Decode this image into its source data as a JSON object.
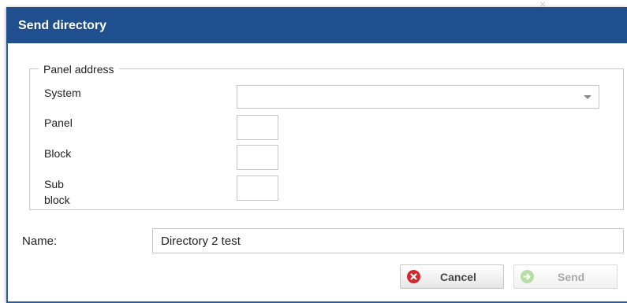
{
  "dialog": {
    "title": "Send directory"
  },
  "panel_address": {
    "legend": "Panel address",
    "system_label": "System",
    "system_value": "",
    "panel_label": "Panel",
    "panel_value": "",
    "block_label": "Block",
    "block_value": "",
    "sub_block_label_line1": "Sub",
    "sub_block_label_line2": "block",
    "sub_block_value": ""
  },
  "name": {
    "label": "Name:",
    "value": "Directory 2 test"
  },
  "buttons": {
    "cancel_label": "Cancel",
    "send_label": "Send"
  },
  "icons": {
    "cancel": "close-circle-icon",
    "send": "arrow-right-circle-icon",
    "dropdown": "chevron-down-icon",
    "background_close": "close-icon"
  },
  "colors": {
    "titlebar": "#1f4f8e",
    "cancel_icon": "#d7262b",
    "send_icon": "#b6dfa5"
  }
}
